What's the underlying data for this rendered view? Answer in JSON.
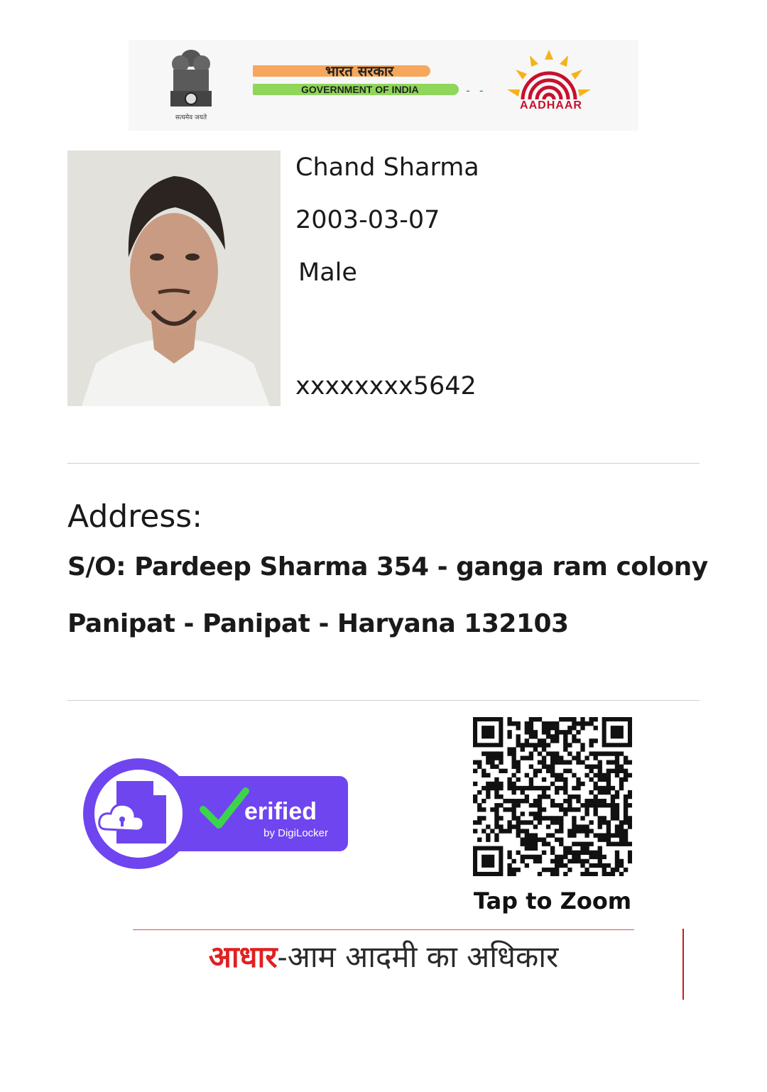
{
  "header": {
    "emblem_motto": "सत्यमेव जयते",
    "gov_hindi": "भारत सरकार",
    "gov_english": "GOVERNMENT OF INDIA",
    "aadhaar_logo_text": "AADHAAR"
  },
  "person": {
    "name": "Chand Sharma",
    "dob": "2003-03-07",
    "gender": "Male",
    "aadhaar_masked": "xxxxxxxx5642"
  },
  "address": {
    "label": "Address:",
    "line1": "S/O: Pardeep Sharma 354 - ganga ram colony",
    "line2": "Panipat - Panipat - Haryana 132103"
  },
  "badge": {
    "verified_text": "erified",
    "by_text": "by DigiLocker"
  },
  "qr": {
    "tap_label": "Tap to Zoom"
  },
  "footer": {
    "red_part": "आधार",
    "rest": "-आम आदमी का अधिकार"
  },
  "colors": {
    "badge_purple": "#6f45f0",
    "check_green": "#3cd44a",
    "aadhaar_red": "#c8102e",
    "aadhaar_yellow": "#f6b21b"
  }
}
